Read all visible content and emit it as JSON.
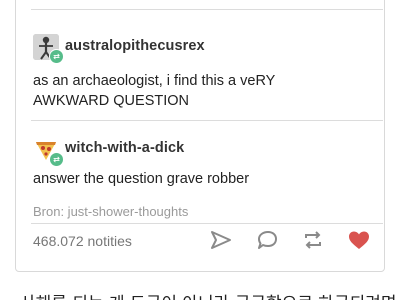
{
  "top_clipped_text": "g",
  "posts": [
    {
      "username": "australopithecusrex",
      "avatar_icon": "skeleton-figure-icon",
      "text_lines": [
        "as an archaeologist, i find this a veRY",
        "AWKWARD QUESTION"
      ]
    },
    {
      "username": "witch-with-a-dick",
      "avatar_icon": "pizza-slice-icon",
      "text_lines": [
        "answer the question grave robber"
      ]
    }
  ],
  "source": "Bron: just-shower-thoughts",
  "notes_count": "468.072 notities",
  "actions": [
    "share-icon",
    "reply-icon",
    "reblog-icon",
    "like-heart-icon"
  ],
  "colors": {
    "reblog_badge": "#56bc8a",
    "like_heart": "#d9534f",
    "icon_gray": "#8a8a8a"
  },
  "bottom_caption": "사해를 되는 게 도굴이 아니라 궁금함으로 하굴되려면 사"
}
